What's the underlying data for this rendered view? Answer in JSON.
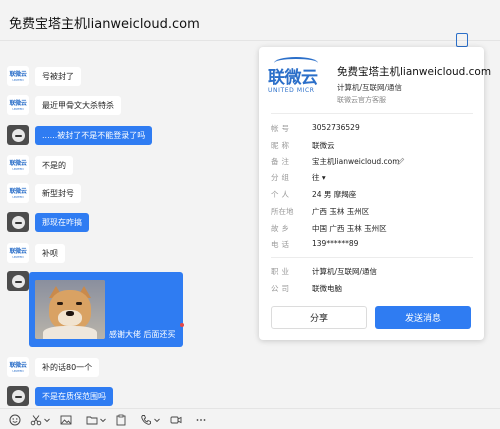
{
  "window": {
    "title": "免费宝塔主机lianweicloud.com"
  },
  "messages": [
    {
      "side": "in",
      "text": "号被封了"
    },
    {
      "side": "in",
      "text": "最近甲骨文大杀特杀"
    },
    {
      "side": "out",
      "text": "......被封了不是不能登录了吗"
    },
    {
      "side": "in",
      "text": "不是的"
    },
    {
      "side": "in",
      "text": "新型封号"
    },
    {
      "side": "out",
      "text": "那现在咋搞"
    },
    {
      "side": "in",
      "text": "补呗"
    },
    {
      "side": "out",
      "text": "感谢大佬  后面还买",
      "type": "image"
    },
    {
      "side": "in",
      "text": "补的话80一个"
    },
    {
      "side": "out",
      "text": "不是在质保范围吗"
    }
  ],
  "avatar_brand": {
    "text": "联微云",
    "sub": "UNITED"
  },
  "profile": {
    "logo_cn": "联微云",
    "logo_en": "UNITED MICR",
    "name": "免费宝塔主机lianweicloud.com",
    "industry": "计算机/互联网/通信",
    "subtitle": "联微云官方客服",
    "fields": [
      {
        "key": "帐号",
        "value": "3052736529"
      },
      {
        "key": "昵称",
        "value": "联微云"
      },
      {
        "key": "备注",
        "value": "宝主机lianweicloud.com"
      },
      {
        "key": "分组",
        "value": "往 ▾"
      },
      {
        "key": "个人",
        "value": "24 男 摩羯座"
      },
      {
        "key": "所在地",
        "value": "广西 玉林 玉州区"
      },
      {
        "key": "故乡",
        "value": "中国 广西 玉林 玉州区"
      },
      {
        "key": "电话",
        "value": "139******89"
      },
      {
        "key": "职业",
        "value": "计算机/互联网/通信"
      },
      {
        "key": "公司",
        "value": "联微电脑"
      }
    ],
    "share_label": "分享",
    "send_label": "发送消息"
  },
  "toolbar": {
    "icons": [
      "emoji-icon",
      "scissors-icon",
      "chevron-down-icon",
      "image-icon",
      "folder-icon",
      "chevron-down-icon",
      "phone-icon",
      "video-icon",
      "chevron-down-icon",
      "more-icon"
    ]
  },
  "colors": {
    "accent": "#2f7cf2",
    "brand": "#2b6fc9",
    "background": "#f3f3f3"
  }
}
